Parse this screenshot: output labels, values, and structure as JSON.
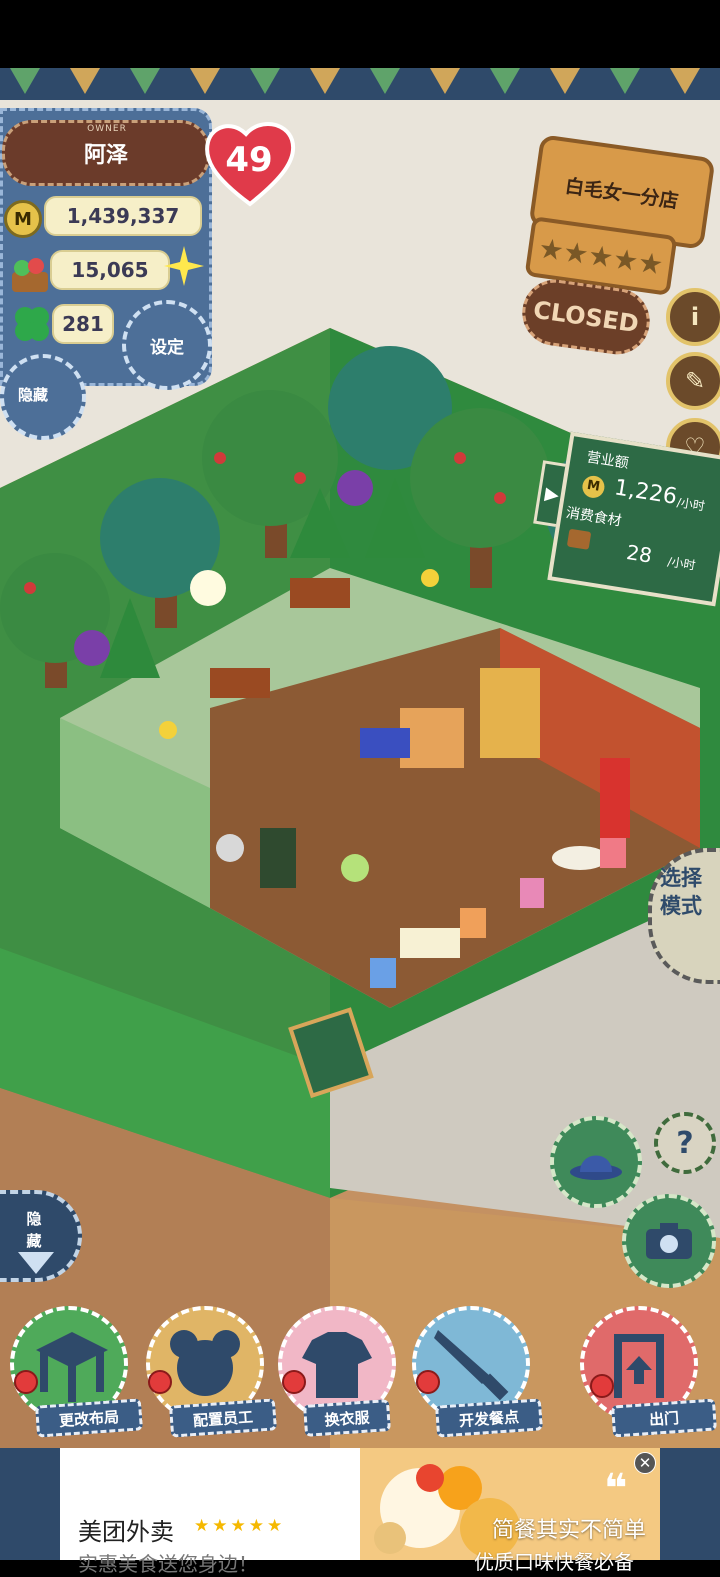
{
  "owner": {
    "caption": "OWNER",
    "name": "阿泽",
    "level": "49",
    "coins": "1,439,337",
    "food": "15,065",
    "clover": "281",
    "coin_icon": "M",
    "settings_label": "设定",
    "hide_label": "隐藏"
  },
  "store": {
    "name": "白毛女一分店",
    "status": "CLOSED",
    "stars": "★★★★★"
  },
  "stats": {
    "revenue_label": "营业额",
    "revenue_value": "1,226",
    "revenue_unit": "/小时",
    "food_label": "消费食材",
    "food_value": "28",
    "food_unit": "/小时",
    "arrow": "▶"
  },
  "side_buttons": {
    "info": "i",
    "book": "✎",
    "chat": "♡"
  },
  "select_mode_label": "选择模式",
  "help_label": "?",
  "hide_bottom_label": "隐藏",
  "actions": [
    {
      "label": "更改布局"
    },
    {
      "label": "配置员工"
    },
    {
      "label": "换衣服"
    },
    {
      "label": "开发餐点"
    },
    {
      "label": "出门"
    }
  ],
  "ad": {
    "title": "美团外卖",
    "stars": "★★★★★",
    "subtitle": "实惠美食送您身边！",
    "quote_mark": "❝",
    "line1": "简餐其实不简单",
    "line2": "优质口味快餐必备",
    "close": "✕"
  },
  "colors": {
    "panel_blue": "#4d6f98",
    "heart_red": "#e03a4a",
    "sign_wood": "#d89a49",
    "board_green": "#2d6a45",
    "grass": "#3e9a46"
  }
}
